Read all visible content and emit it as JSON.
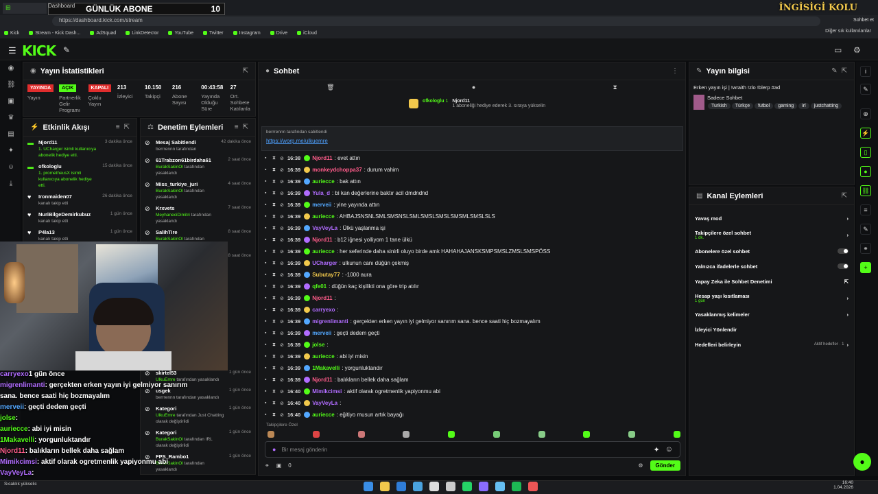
{
  "browser": {
    "overlay_label": "GÜNLÜK ABONE",
    "overlay_count": "10",
    "tab_label": "Dashboard",
    "url": "https://dashboard.kick.com/stream",
    "channel_logo": "İNGİSİGİ KOLU",
    "chat_button": "Sohbet et",
    "other_bookmarks": "Diğer sık kullanılanlar",
    "bookmarks": [
      "Kick",
      "Stream - Kick Dash...",
      "AdSquad",
      "LinkDetector",
      "YouTube",
      "Twitter",
      "Instagram",
      "Drive",
      "iCloud"
    ]
  },
  "app": {
    "logo": "KICK"
  },
  "stats": {
    "title": "Yayın İstatistikleri",
    "items": [
      {
        "badge": "YAYINDA",
        "badge_color": "red",
        "label": "Yayın"
      },
      {
        "badge": "AÇIK",
        "badge_color": "green",
        "label": "Partnerlik Gelir Programı"
      },
      {
        "badge": "KAPALI",
        "badge_color": "red",
        "label": "Çoklu Yayın"
      },
      {
        "num": "213",
        "label": "İzleyici"
      },
      {
        "num": "10.150",
        "label": "Takipçi"
      },
      {
        "num": "216",
        "label": "Abone Sayısı"
      },
      {
        "num": "00:43:58",
        "label": "Yayında Olduğu Süre"
      },
      {
        "num": "27",
        "label": "Ort. Sohbete Katılanla"
      }
    ]
  },
  "events": {
    "title": "Etkinlik Akışı",
    "items": [
      {
        "name": "Njord11",
        "sub": "1. UCharger isimli kullanıcıya abonelik hediye etti.",
        "time": "3 dakika önce"
      },
      {
        "name": "ofkologlu",
        "sub": "1. prometheusX isimli kullanıcıya abonelik hediye etti.",
        "time": "15 dakika önce"
      },
      {
        "name": "Ironmaiden07",
        "sub2": "kanalı takip etti",
        "time": "26 dakika önce"
      },
      {
        "name": "NuriBilgeDemirkubuz",
        "sub2": "kanalı takip etti",
        "time": "1 gün önce"
      },
      {
        "name": "P4la13",
        "sub2": "kanalı takip etti",
        "time": "1 gün önce"
      }
    ]
  },
  "audit": {
    "title": "Denetim Eylemleri",
    "items": [
      {
        "name": "Mesaj Sabitlendi",
        "sub2": "berrrennn tarafından",
        "time": "42 dakika önce"
      },
      {
        "name": "61Trabzon61birdaha61",
        "sub": "BurakSakinOl",
        "sub2": " tarafından yasaklandı",
        "time": "2 saat önce"
      },
      {
        "name": "Miss_turkiye_juri",
        "sub": "BurakSakinOl",
        "sub2": " tarafından yasaklandı",
        "time": "4 saat önce"
      },
      {
        "name": "Krxvets",
        "sub": "MeyhaneciDimitri",
        "sub2": " tarafından yasaklandı",
        "time": "7 saat önce"
      },
      {
        "name": "SalihTire",
        "sub": "BurakSakinOl",
        "sub2": " tarafından yasaklandı",
        "time": "8 saat önce"
      },
      {
        "name": "SalihTire",
        "sub": "MeyhaneciDimitri",
        "sub2": "",
        "time": "8 saat önce"
      }
    ],
    "lower": [
      {
        "name": "skirtel53",
        "sub": "UlkuEmre",
        "sub2": " tarafından yasaklandı",
        "time": "1 gün önce"
      },
      {
        "name": "usgek",
        "sub2": "berrrennn tarafından yasaklandı",
        "time": "1 gün önce"
      },
      {
        "name": "Kategori",
        "sub": "UlkuEmre",
        "sub2": " tarafından Just Chatting olarak değiştirildi",
        "time": "1 gün önce"
      },
      {
        "name": "Kategori",
        "sub": "BurakSakinOl",
        "sub2": " tarafından IRL olarak değiştirildi",
        "time": "1 gün önce"
      },
      {
        "name": "FPS_Rambo1",
        "sub": "BurakSakinOl",
        "sub2": " tarafından yasaklandı",
        "time": "1 gün önce"
      }
    ]
  },
  "overlay_chat": [
    {
      "user": "carryexo",
      "user_color": "#b16cff",
      "text": "1 gün önce"
    },
    {
      "user": "migrenlimanti",
      "user_color": "#b16cff",
      "text": ": gerçekten erken yayın iyi gelmiyor sanırım"
    },
    {
      "user": "",
      "user_color": "#fff",
      "text": "sana. bence saati hiç bozmayalım"
    },
    {
      "user": "merveii",
      "user_color": "#53a8ff",
      "text": ": geçti dedem geçti"
    },
    {
      "user": "jolse",
      "user_color": "#53fc18",
      "text": ":"
    },
    {
      "user": "auriecce",
      "user_color": "#53fc18",
      "text": ": abi iyi misin"
    },
    {
      "user": "1Makavelli",
      "user_color": "#53fc18",
      "text": ": yorgunluktandır"
    },
    {
      "user": "Njord11",
      "user_color": "#ff5c8a",
      "text": ": balıkların bellek daha sağlam"
    },
    {
      "user": "Mimikcimsi",
      "user_color": "#b16cff",
      "text": ": aktif olarak ogretmenlik yapiyonmu abi"
    },
    {
      "user": "VayVeyLa",
      "user_color": "#b16cff",
      "text": ":"
    },
    {
      "user": "auriecce",
      "user_color": "#53fc18",
      "text": ": eğitiyo musun artık bayağı"
    }
  ],
  "chat": {
    "title": "Sohbet",
    "gifter": "ofkologlu",
    "gifter_count": "1",
    "gift_user": "Njord11",
    "gift_note": "1 aboneliği hediye ederek 3. sıraya yükselin",
    "pinned_by": "berrrennn tarafından sabitlendi",
    "pinned_link": "https://worp.me/ulkuemre",
    "follow_label": "Takipçilere Özel",
    "placeholder": "Bir mesaj gönderin",
    "send": "Gönder",
    "viewer_count": "0",
    "messages": [
      {
        "t": "16:38",
        "u": "Njord11",
        "c": "#ff5c8a",
        "m": ": evet attın"
      },
      {
        "t": "16:39",
        "u": "monkeydchoppa37",
        "c": "#ff5c8a",
        "m": ": durum vahim"
      },
      {
        "t": "16:39",
        "u": "auriecce",
        "c": "#53fc18",
        "m": ": bak attın"
      },
      {
        "t": "16:39",
        "u": "Yula_d",
        "c": "#b16cff",
        "m": ": bi kan değerlerine baktır acil dmdndnd"
      },
      {
        "t": "16:39",
        "u": "merveii",
        "c": "#53a8ff",
        "m": ": yine yayında attın"
      },
      {
        "t": "16:39",
        "u": "auriecce",
        "c": "#53fc18",
        "m": ": AHBAJSNSNLSMLSMSNSLSMLSMSLSMSLSMSMLSMSLSLS"
      },
      {
        "t": "16:39",
        "u": "VayVeyLa",
        "c": "#b16cff",
        "m": ": Ülkü yaşlanma işi"
      },
      {
        "t": "16:39",
        "u": "Njord11",
        "c": "#ff5c8a",
        "m": ": b12 iğnesi yolliyom 1 tane ülkü"
      },
      {
        "t": "16:39",
        "u": "auriecce",
        "c": "#53fc18",
        "m": ": her seferinde daha sinirli oluyo birde amk HAHAHAJANSKSMPSMSLZMSLSMSPÖSS"
      },
      {
        "t": "16:39",
        "u": "UCharger",
        "c": "#b16cff",
        "m": ": ulkunun canı düğün çekmiş"
      },
      {
        "t": "16:39",
        "u": "Subutay77",
        "c": "#f2c94c",
        "m": ": -1000 aura"
      },
      {
        "t": "16:39",
        "u": "qfe01",
        "c": "#53fc18",
        "m": ": düğün kaç kişilikti ona göre trip atılır"
      },
      {
        "t": "16:39",
        "u": "Njord11",
        "c": "#ff5c8a",
        "m": ":"
      },
      {
        "t": "16:39",
        "u": "carryexo",
        "c": "#b16cff",
        "m": ":"
      },
      {
        "t": "16:39",
        "u": "migrenlimanti",
        "c": "#b16cff",
        "m": ": gerçekten erken yayın iyi gelmiyor sanırım sana. bence saati hiç bozmayalım"
      },
      {
        "t": "16:39",
        "u": "merveii",
        "c": "#53a8ff",
        "m": ": geçti dedem geçti"
      },
      {
        "t": "16:39",
        "u": "jolse",
        "c": "#53fc18",
        "m": ":"
      },
      {
        "t": "16:39",
        "u": "auriecce",
        "c": "#53fc18",
        "m": ": abi iyi misin"
      },
      {
        "t": "16:39",
        "u": "1Makavelli",
        "c": "#53fc18",
        "m": ": yorgunluktandır"
      },
      {
        "t": "16:39",
        "u": "Njord11",
        "c": "#ff5c8a",
        "m": ": balıkların bellek daha sağlam"
      },
      {
        "t": "16:40",
        "u": "Mimikcimsi",
        "c": "#b16cff",
        "m": ": aktif olarak ogretmenlik yapiyonmu abi"
      },
      {
        "t": "16:40",
        "u": "VayVeyLa",
        "c": "#b16cff",
        "m": ":"
      },
      {
        "t": "16:40",
        "u": "auriecce",
        "c": "#53fc18",
        "m": ": eğitiyo musun artık bayağı"
      }
    ]
  },
  "info": {
    "title": "Yayın bilgisi",
    "stream_title": "Erken yayın işi | !wraith !zlo !blerp #ad",
    "category": "Sadece Sohbet",
    "tags": [
      "Turkish",
      "Türkçe",
      "futbol",
      "gaming",
      "irl",
      "justchatting"
    ]
  },
  "actions": {
    "title": "Kanal Eylemleri",
    "items": [
      {
        "label": "Yavaş mod",
        "control": "chevron"
      },
      {
        "label": "Takipçilere özel sohbet",
        "sub": "1 dk.",
        "control": "chevron"
      },
      {
        "label": "Abonelere özel sohbet",
        "control": "toggle"
      },
      {
        "label": "Yalnızca ifadelerle sohbet",
        "control": "toggle"
      },
      {
        "label": "Yapay Zeka ile Sohbet Denetimi",
        "control": "ext"
      },
      {
        "label": "Hesap yaşı kısıtlaması",
        "sub": "1 gün",
        "control": "chevron"
      },
      {
        "label": "Yasaklanmış kelimeler",
        "control": "chevron"
      },
      {
        "label": "İzleyici Yönlendir",
        "control": ""
      },
      {
        "label": "Hedefleri belirleyin",
        "control": "chevron",
        "extra": "Aktif hedefler · 1"
      }
    ]
  },
  "taskbar": {
    "time": "16:40",
    "date": "1.04.2026",
    "weather": "Sıcaklık yükselic"
  }
}
